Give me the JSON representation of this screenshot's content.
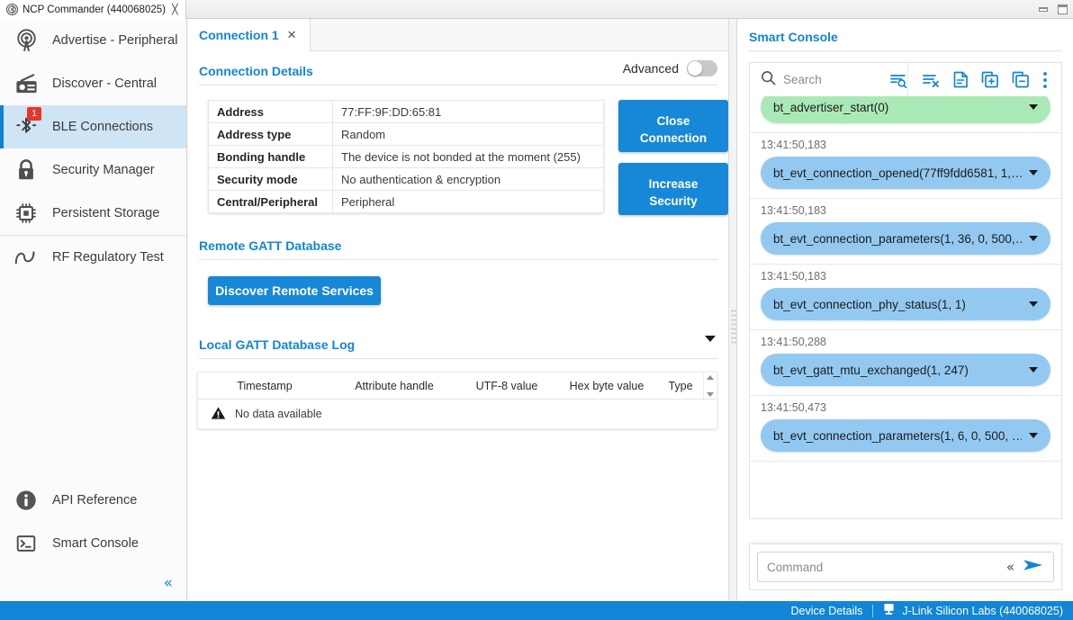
{
  "window": {
    "tab_title": "NCP Commander (440068025)",
    "tab_close": "╳",
    "minimize_name": "minimize",
    "maximize_name": "maximize"
  },
  "sidebar": {
    "items": [
      {
        "label": "Advertise - Peripheral",
        "icon": "antenna-icon",
        "active": false
      },
      {
        "label": "Discover - Central",
        "icon": "radio-icon",
        "active": false
      },
      {
        "label": "BLE Connections",
        "icon": "bluetooth-icon",
        "active": true,
        "badge": "1"
      },
      {
        "label": "Security Manager",
        "icon": "lock-icon",
        "active": false
      },
      {
        "label": "Persistent Storage",
        "icon": "chip-icon",
        "active": false
      },
      {
        "label": "RF Regulatory Test",
        "icon": "waveform-icon",
        "active": false
      }
    ],
    "bottom_items": [
      {
        "label": "API Reference",
        "icon": "info-icon"
      },
      {
        "label": "Smart Console",
        "icon": "terminal-icon"
      }
    ],
    "collapse_glyph": "«"
  },
  "center": {
    "tab": {
      "label": "Connection 1",
      "close": "✕"
    },
    "connection_details": {
      "title": "Connection Details",
      "advanced_label": "Advanced",
      "advanced_on": false,
      "rows": [
        {
          "key": "Address",
          "value": "77:FF:9F:DD:65:81"
        },
        {
          "key": "Address type",
          "value": "Random"
        },
        {
          "key": "Bonding handle",
          "value": "The device is not bonded at the moment (255)"
        },
        {
          "key": "Security mode",
          "value": "No authentication & encryption"
        },
        {
          "key": "Central/Peripheral",
          "value": "Peripheral"
        }
      ],
      "buttons": {
        "close_connection_line1": "Close",
        "close_connection_line2": "Connection",
        "increase_security_line1": "Increase",
        "increase_security_line2": "Security"
      }
    },
    "remote_gatt": {
      "title": "Remote GATT Database",
      "discover_button": "Discover Remote Services"
    },
    "local_gatt_log": {
      "title": "Local GATT Database Log",
      "columns": [
        "Timestamp",
        "Attribute handle",
        "UTF-8 value",
        "Hex byte value",
        "Type"
      ],
      "empty_message": "No data available"
    }
  },
  "console": {
    "title": "Smart Console",
    "search_placeholder": "Search",
    "toolbar_icons": [
      "search-filter-icon",
      "clear-log-icon",
      "save-log-icon",
      "copy-add-icon",
      "copy-remove-icon",
      "more-options-icon"
    ],
    "entries": [
      {
        "timestamp": "",
        "text": "bt_advertiser_start(0)",
        "kind": "cmd"
      },
      {
        "timestamp": "13:41:50,183",
        "text": "bt_evt_connection_opened(77ff9fdd6581, 1,…",
        "kind": "evt"
      },
      {
        "timestamp": "13:41:50,183",
        "text": "bt_evt_connection_parameters(1, 36, 0, 500,…",
        "kind": "evt"
      },
      {
        "timestamp": "13:41:50,183",
        "text": "bt_evt_connection_phy_status(1, 1)",
        "kind": "evt"
      },
      {
        "timestamp": "13:41:50,288",
        "text": "bt_evt_gatt_mtu_exchanged(1, 247)",
        "kind": "evt"
      },
      {
        "timestamp": "13:41:50,473",
        "text": "bt_evt_connection_parameters(1, 6, 0, 500, …",
        "kind": "evt"
      }
    ],
    "command_placeholder": "Command",
    "command_value": "",
    "expand_glyph": "«"
  },
  "statusbar": {
    "device_details": "Device Details",
    "adapter": "J-Link Silicon Labs (440068025)"
  },
  "colors": {
    "accent": "#1385d6",
    "status_bar": "#1385d6",
    "badge_red": "#e8352b",
    "pill_command": "#aae9b6",
    "pill_event": "#93c9f0",
    "sidebar_active": "#cfe4f4"
  }
}
